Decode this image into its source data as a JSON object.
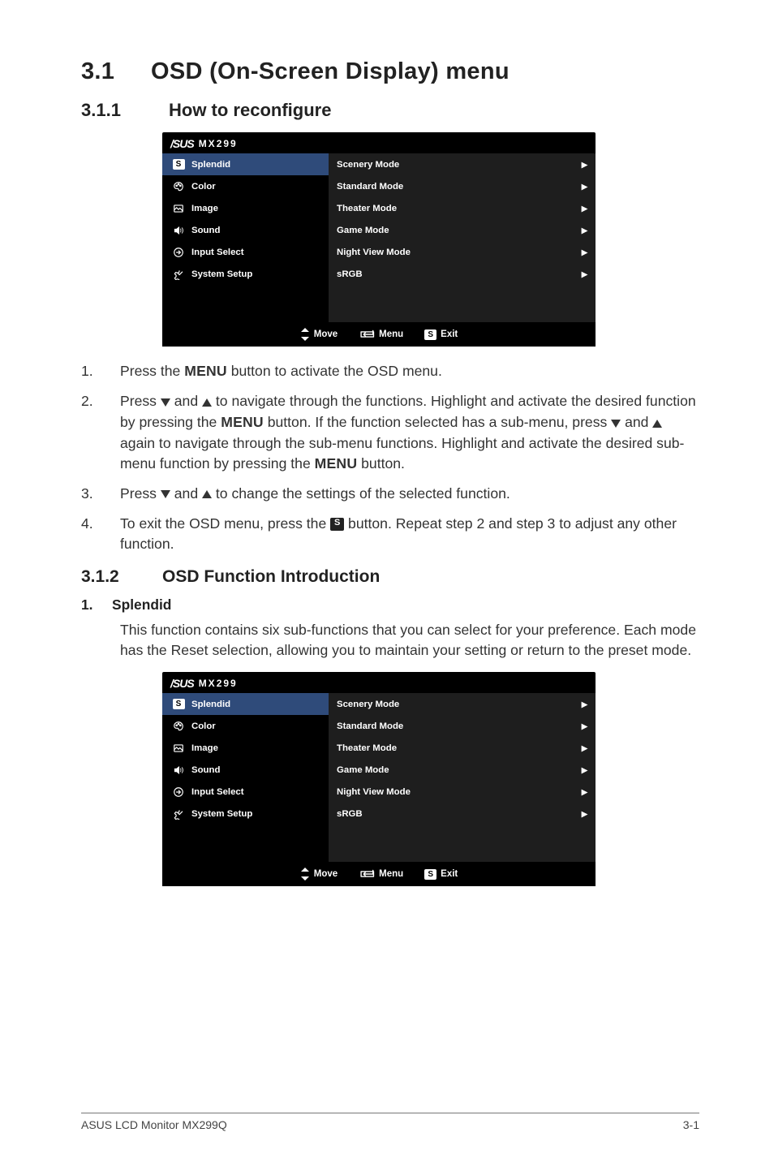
{
  "section": {
    "num": "3.1",
    "title": "OSD (On-Screen Display) menu"
  },
  "sub1": {
    "num": "3.1.1",
    "title": "How to reconfigure"
  },
  "sub2": {
    "num": "3.1.2",
    "title": "OSD Function Introduction"
  },
  "osd": {
    "brand": "/SUS",
    "model": "MX299",
    "left_items": [
      {
        "label": "Splendid"
      },
      {
        "label": "Color"
      },
      {
        "label": "Image"
      },
      {
        "label": "Sound"
      },
      {
        "label": "Input Select"
      },
      {
        "label": "System Setup"
      }
    ],
    "right_items": [
      {
        "label": "Scenery Mode"
      },
      {
        "label": "Standard Mode"
      },
      {
        "label": "Theater Mode"
      },
      {
        "label": "Game Mode"
      },
      {
        "label": "Night View Mode"
      },
      {
        "label": "sRGB"
      }
    ],
    "footer": {
      "move": "Move",
      "menu": "Menu",
      "exit": "Exit"
    }
  },
  "steps": {
    "s1_marker": "1.",
    "s1_a": "Press the ",
    "s1_menu": "MENU",
    "s1_b": " button to activate the OSD menu.",
    "s2_marker": "2.",
    "s2_a": "Press ",
    "s2_b": " and ",
    "s2_c": " to navigate through the functions. Highlight and activate the desired function by pressing the ",
    "s2_menu1": "MENU",
    "s2_d": " button. If the function selected has a sub-menu, press ",
    "s2_e": " and ",
    "s2_f": " again to navigate through the sub-menu functions. Highlight and activate the desired sub-menu function by pressing the ",
    "s2_menu2": "MENU",
    "s2_g": " button.",
    "s3_marker": "3.",
    "s3_a": "Press ",
    "s3_b": " and ",
    "s3_c": " to change the settings of the selected function.",
    "s4_marker": "4.",
    "s4_a": "To exit the OSD menu, press the ",
    "s4_s": "S",
    "s4_b": " button. Repeat step 2 and step 3 to adjust any other function."
  },
  "splendid": {
    "heading_num": "1.",
    "heading_label": "Splendid",
    "para": "This function contains six sub-functions that you can select for your preference. Each mode has the Reset selection, allowing you to maintain your setting or return to the preset mode."
  },
  "footer": {
    "left": "ASUS LCD Monitor MX299Q",
    "right": "3-1"
  },
  "glyphs": {
    "s_badge": "S",
    "right_arrow": "▶"
  }
}
